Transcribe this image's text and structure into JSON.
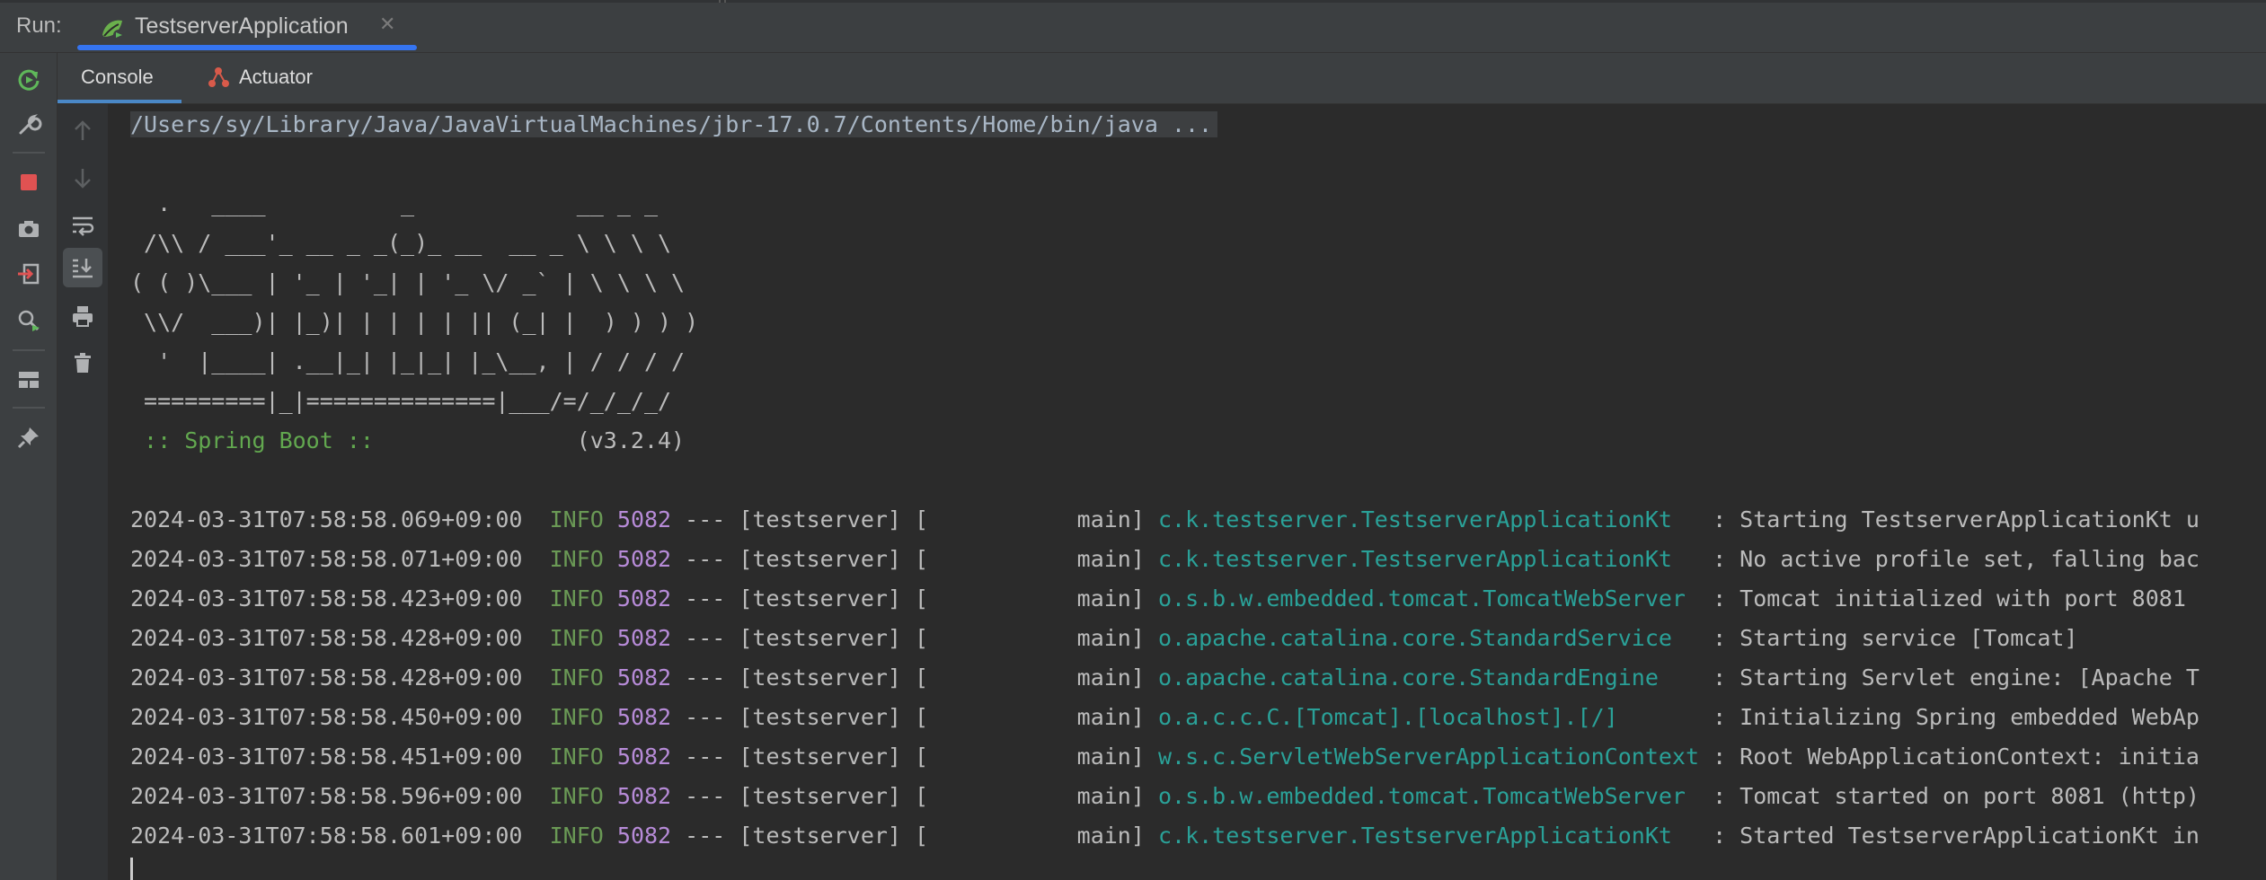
{
  "run_bar": {
    "label": "Run:",
    "tab_title": "TestserverApplication",
    "close_glyph": "✕"
  },
  "sub_tabs": [
    {
      "label": "Console",
      "active": true
    },
    {
      "label": "Actuator",
      "active": false
    }
  ],
  "left_toolbar_icons": [
    "rerun-icon",
    "wrench-icon",
    "stop-icon",
    "camera-icon",
    "exit-icon",
    "debug-search-icon",
    "layout-icon",
    "pin-icon"
  ],
  "console_toolbar_icons": [
    "up-arrow-icon",
    "down-arrow-icon",
    "soft-wrap-icon",
    "scroll-to-end-icon",
    "print-icon",
    "trash-icon"
  ],
  "console": {
    "command": "/Users/sy/Library/Java/JavaVirtualMachines/jbr-17.0.7/Contents/Home/bin/java ...",
    "banner": [
      "  .   ____          _            __ _ _",
      " /\\\\ / ___'_ __ _ _(_)_ __  __ _ \\ \\ \\ \\",
      "( ( )\\___ | '_ | '_| | '_ \\/ _` | \\ \\ \\ \\",
      " \\\\/  ___)| |_)| | | | | || (_| |  ) ) ) )",
      "  '  |____| .__|_| |_|_| |_\\__, | / / / /",
      " =========|_|==============|___/=/_/_/_/"
    ],
    "spring_label": " :: Spring Boot :: ",
    "spring_version": "              (v3.2.4)",
    "log_rows": [
      {
        "timestamp": "2024-03-31T07:58:58.069+09:00",
        "level": "INFO",
        "pid": "5082",
        "thread": " --- [testserver] [           main] ",
        "logger": "c.k.testserver.TestserverApplicationKt  ",
        "message": " : Starting TestserverApplicationKt u"
      },
      {
        "timestamp": "2024-03-31T07:58:58.071+09:00",
        "level": "INFO",
        "pid": "5082",
        "thread": " --- [testserver] [           main] ",
        "logger": "c.k.testserver.TestserverApplicationKt  ",
        "message": " : No active profile set, falling bac"
      },
      {
        "timestamp": "2024-03-31T07:58:58.423+09:00",
        "level": "INFO",
        "pid": "5082",
        "thread": " --- [testserver] [           main] ",
        "logger": "o.s.b.w.embedded.tomcat.TomcatWebServer ",
        "message": " : Tomcat initialized with port 8081"
      },
      {
        "timestamp": "2024-03-31T07:58:58.428+09:00",
        "level": "INFO",
        "pid": "5082",
        "thread": " --- [testserver] [           main] ",
        "logger": "o.apache.catalina.core.StandardService  ",
        "message": " : Starting service [Tomcat]"
      },
      {
        "timestamp": "2024-03-31T07:58:58.428+09:00",
        "level": "INFO",
        "pid": "5082",
        "thread": " --- [testserver] [           main] ",
        "logger": "o.apache.catalina.core.StandardEngine   ",
        "message": " : Starting Servlet engine: [Apache T"
      },
      {
        "timestamp": "2024-03-31T07:58:58.450+09:00",
        "level": "INFO",
        "pid": "5082",
        "thread": " --- [testserver] [           main] ",
        "logger": "o.a.c.c.C.[Tomcat].[localhost].[/]      ",
        "message": " : Initializing Spring embedded WebAp"
      },
      {
        "timestamp": "2024-03-31T07:58:58.451+09:00",
        "level": "INFO",
        "pid": "5082",
        "thread": " --- [testserver] [           main] ",
        "logger": "w.s.c.ServletWebServerApplicationContext",
        "message": " : Root WebApplicationContext: initia"
      },
      {
        "timestamp": "2024-03-31T07:58:58.596+09:00",
        "level": "INFO",
        "pid": "5082",
        "thread": " --- [testserver] [           main] ",
        "logger": "o.s.b.w.embedded.tomcat.TomcatWebServer ",
        "message": " : Tomcat started on port 8081 (http)"
      },
      {
        "timestamp": "2024-03-31T07:58:58.601+09:00",
        "level": "INFO",
        "pid": "5082",
        "thread": " --- [testserver] [           main] ",
        "logger": "c.k.testserver.TestserverApplicationKt  ",
        "message": " : Started TestserverApplicationKt in"
      }
    ]
  },
  "colors": {
    "accent": "#3574f0",
    "info_level": "#6a9955",
    "pid": "#b78bd8",
    "logger": "#2aa198",
    "stop": "#e05252",
    "rerun": "#5fb85a"
  }
}
